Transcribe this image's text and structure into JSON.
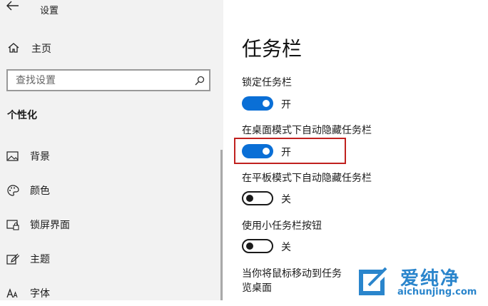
{
  "app": {
    "title": "设置"
  },
  "sidebar": {
    "home_label": "主页",
    "search_placeholder": "查找设置",
    "section_header": "个性化",
    "items": [
      {
        "icon": "picture-icon",
        "label": "背景"
      },
      {
        "icon": "palette-icon",
        "label": "颜色"
      },
      {
        "icon": "lock-screen-icon",
        "label": "锁屏界面"
      },
      {
        "icon": "theme-brush-icon",
        "label": "主题"
      },
      {
        "icon": "font-icon",
        "label": "字体"
      }
    ]
  },
  "main": {
    "title": "任务栏",
    "settings": [
      {
        "label": "锁定任务栏",
        "state": "开",
        "on": true
      },
      {
        "label": "在桌面模式下自动隐藏任务栏",
        "state": "开",
        "on": true
      },
      {
        "label": "在平板模式下自动隐藏任务栏",
        "state": "关",
        "on": false
      },
      {
        "label": "使用小任务栏按钮",
        "state": "关",
        "on": false
      }
    ],
    "partial_text_line1": "当你将鼠标移动到任务",
    "partial_text_line2": "览桌面"
  },
  "colors": {
    "accent": "#0a6fd6",
    "highlight_border": "#c0211f",
    "sidebar_bg": "#f2f2f2"
  },
  "watermark": {
    "text_cn": "爱纯净",
    "url": "aichunjing.com"
  }
}
